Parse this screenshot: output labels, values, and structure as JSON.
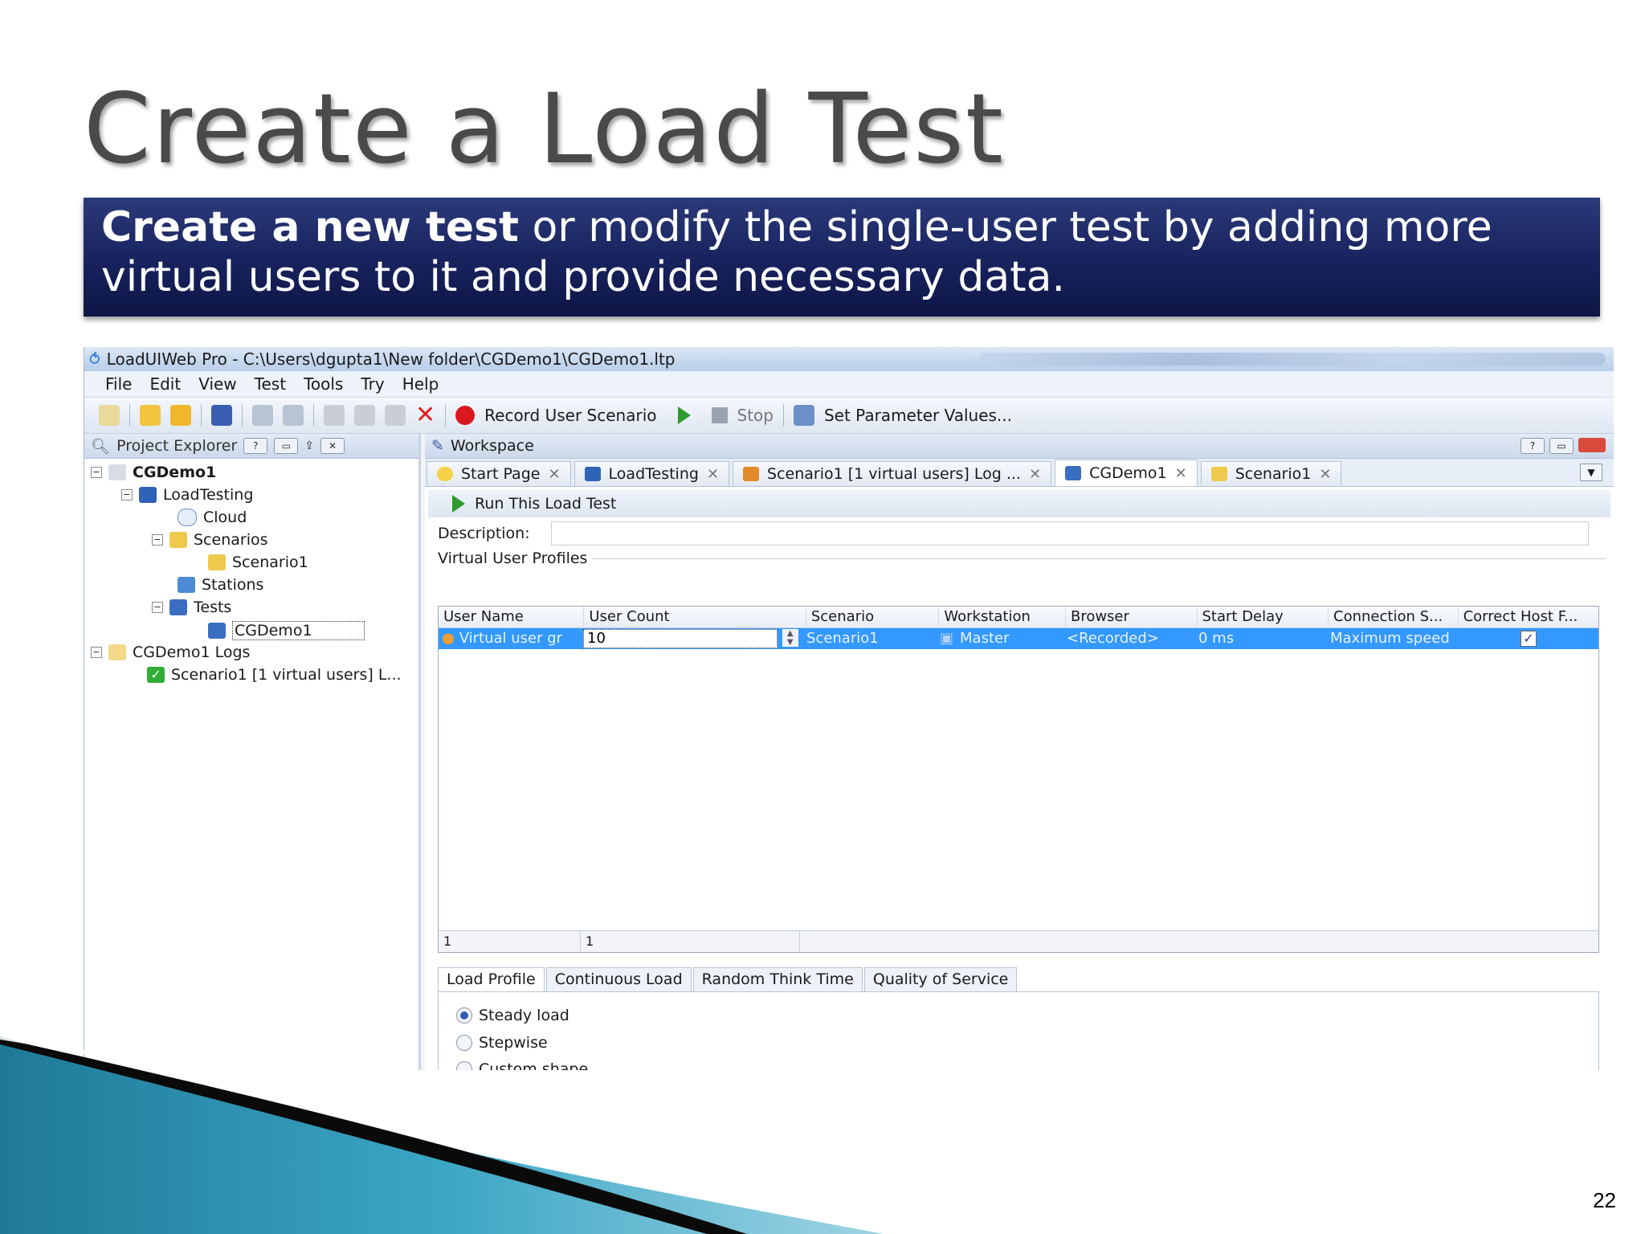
{
  "slide": {
    "title": "Create a Load Test",
    "banner_bold": "Create a new test",
    "banner_rest": " or modify the single-user test by adding more virtual users to it  and provide necessary data.",
    "page_number": "22"
  },
  "app": {
    "window_title": "LoadUIWeb Pro - C:\\Users\\dgupta1\\New folder\\CGDemo1\\CGDemo1.ltp",
    "menu": [
      "File",
      "Edit",
      "View",
      "Test",
      "Tools",
      "Try",
      "Help"
    ],
    "toolbar": {
      "record_label": "Record User Scenario",
      "stop_label": "Stop",
      "set_params_label": "Set Parameter Values..."
    },
    "project_explorer": {
      "title": "Project Explorer",
      "tree": {
        "root": "CGDemo1",
        "load_testing": "LoadTesting",
        "cloud": "Cloud",
        "scenarios": "Scenarios",
        "scenario1": "Scenario1",
        "stations": "Stations",
        "tests": "Tests",
        "test_cgdemo1": "CGDemo1",
        "logs": "CGDemo1 Logs",
        "log_item": "Scenario1 [1 virtual users] L..."
      }
    },
    "workspace": {
      "title": "Workspace",
      "tabs": [
        "Start Page",
        "LoadTesting",
        "Scenario1 [1 virtual users] Log ...",
        "CGDemo1",
        "Scenario1"
      ],
      "active_tab": "CGDemo1",
      "run_label": "Run This Load Test",
      "description_label": "Description:",
      "vup_label": "Virtual User Profiles",
      "columns": [
        "User Name",
        "User Count",
        "Scenario",
        "Workstation",
        "Browser",
        "Start Delay",
        "Connection S...",
        "Correct Host F..."
      ],
      "row": {
        "user_name": "Virtual user gr",
        "user_count": "10",
        "scenario": "Scenario1",
        "workstation": "Master",
        "browser": "<Recorded>",
        "start_delay": "0 ms",
        "connection": "Maximum speed"
      },
      "footer": [
        "1",
        "1"
      ],
      "lower_tabs": [
        "Load Profile",
        "Continuous Load",
        "Random Think Time",
        "Quality of Service"
      ],
      "load_profile_options": [
        "Steady load",
        "Stepwise",
        "Custom shape"
      ]
    }
  },
  "colors": {
    "banner": "#16205a",
    "selection": "#3399ff",
    "record": "#d8181e"
  }
}
